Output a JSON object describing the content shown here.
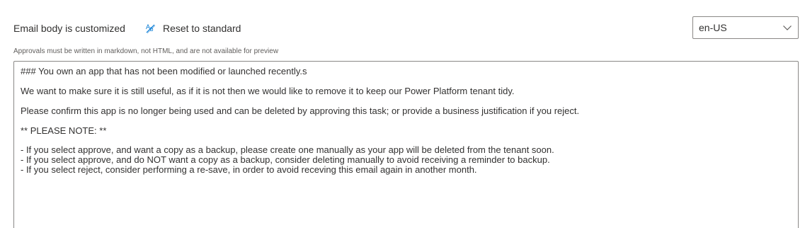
{
  "header": {
    "status_text": "Email body is customized",
    "reset_label": "Reset to standard",
    "reset_icon": "reset-format-icon"
  },
  "language": {
    "selected": "en-US",
    "icon": "chevron-down-icon"
  },
  "hint_text": "Approvals must be written in markdown, not HTML, and are not available for preview",
  "editor": {
    "heading": "### You own an app that has not been modified or launched recently.s",
    "para1": "We want to make sure it is still useful, as if it is not then we would like to remove it to keep our Power Platform tenant tidy.",
    "para2": "Please confirm this app is no longer being used and can be deleted by approving this task; or provide a business justification if you reject.",
    "note": "** PLEASE NOTE: **",
    "bullets": [
      "- If you select approve, and want a copy as a backup, please create one manually as your app will be deleted from the tenant soon.",
      "- If you select approve, and do NOT want a copy as a backup, consider deleting manually to avoid receiving a reminder to backup.",
      "- If you select reject, consider performing a re-save, in order to avoid receving this email again in another month."
    ]
  }
}
